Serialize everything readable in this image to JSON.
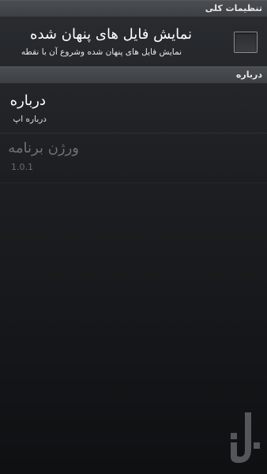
{
  "general_category": {
    "label": "تنظیمات کلی"
  },
  "hidden_files": {
    "title": "نمایش فایل های پنهان شده",
    "summary": "نمایش فایل های پنهان شده وشروع آن با نقطه",
    "checked": false
  },
  "about_category": {
    "label": "درباره"
  },
  "about_item": {
    "title": "درباره",
    "summary": "درباره اپ"
  },
  "version_item": {
    "title": "ورژن برنامه",
    "summary": "1.0.1",
    "enabled": false
  },
  "watermark": {
    "icon": "bazaar-logo-icon"
  }
}
